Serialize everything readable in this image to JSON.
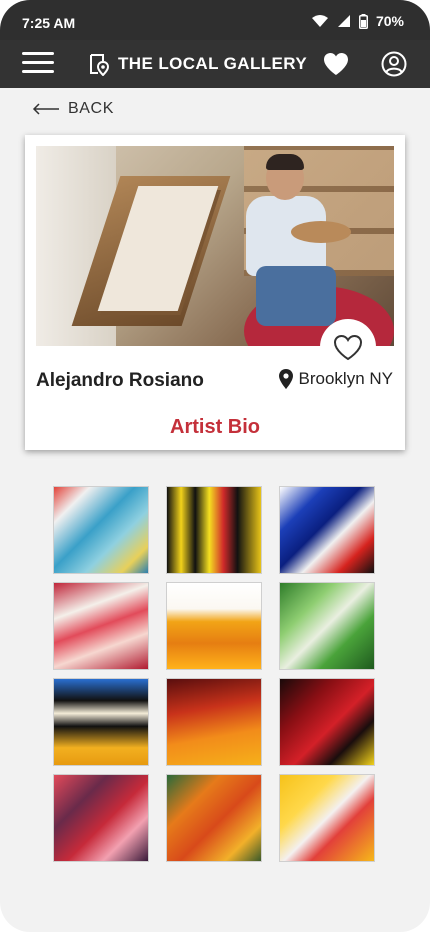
{
  "status": {
    "time": "7:25 AM",
    "battery": "70%"
  },
  "header": {
    "title": "THE LOCAL GALLERY"
  },
  "nav": {
    "back_label": "BACK"
  },
  "artist": {
    "name": "Alejandro Rosiano",
    "location": "Brooklyn NY",
    "bio_label": "Artist Bio"
  },
  "colors": {
    "accent": "#c4303a",
    "appbar": "#333333"
  },
  "gallery": [
    {
      "style": "linear-gradient(135deg,#e2433a 0%,#f0f0f0 20%,#3aa0c8 45%,#8fd0e0 65%,#e8d05a 85%,#2b7fb0 100%)"
    },
    {
      "style": "linear-gradient(90deg,#111 0%,#f2d21a 15%,#111 30%,#f5e020 45%,#d02a2a 60%,#111 75%,#e8c418 100%)"
    },
    {
      "style": "linear-gradient(135deg,#fff 0%,#1c3fb8 25%,#0a1f80 45%,#f0f0f0 60%,#d6231e 80%,#101010 100%)"
    },
    {
      "style": "linear-gradient(160deg,#c0263a 0%,#f4f0ea 30%,#e24b5a 50%,#f6d7d0 70%,#b01a30 100%)"
    },
    {
      "style": "linear-gradient(180deg,#ffffff 0%,#fbf8f2 30%,#f2a416 45%,#e67e12 70%,#ffb21a 100%)"
    },
    {
      "style": "linear-gradient(135deg,#2f7d2a 0%,#8fce72 30%,#e9efe0 50%,#4aa33a 70%,#1e5a1e 100%)"
    },
    {
      "style": "linear-gradient(180deg,#2a6fd0 0%,#111 25%,#f4ecd8 40%,#111 55%,#f2b020 80%,#e79a10 100%)"
    },
    {
      "style": "linear-gradient(170deg,#5a0e0e 0%,#c8321a 35%,#f28c1a 65%,#f6b01a 100%)"
    },
    {
      "style": "linear-gradient(135deg,#1a0a0a 0%,#8a0f14 30%,#d42028 55%,#1a0d0d 75%,#f2d21a 100%)"
    },
    {
      "style": "linear-gradient(135deg,#e24a5a 0%,#6a2a4a 30%,#c62a3a 55%,#f2a0b0 75%,#3a1a3a 100%)"
    },
    {
      "style": "linear-gradient(135deg,#2a6a3a 0%,#e67a1a 30%,#d84a1a 55%,#f2b02a 80%,#3a5a2a 100%)"
    },
    {
      "style": "linear-gradient(135deg,#f6c21a 0%,#ffd84a 30%,#f4f0f0 50%,#e2403a 65%,#f6b81a 100%)"
    }
  ]
}
